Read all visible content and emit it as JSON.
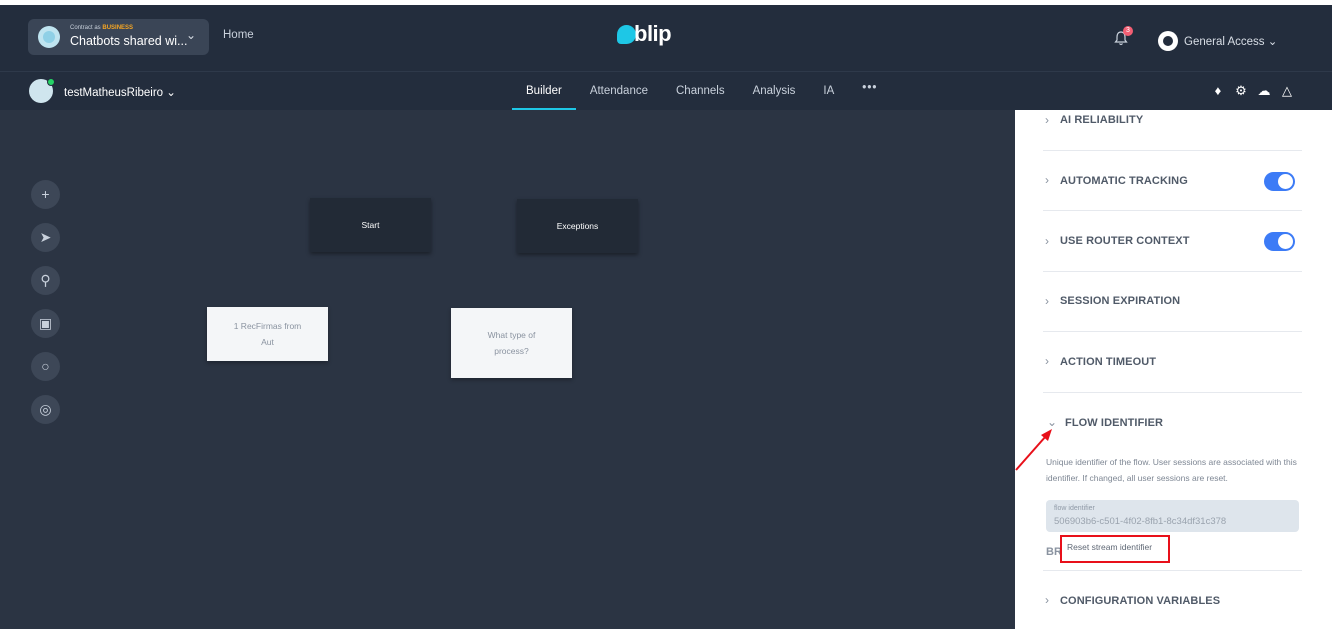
{
  "header": {
    "contract_prefix": "Contract as",
    "contract_plan": "BUSINESS",
    "contract_name": "Chatbots shared wi...",
    "home": "Home",
    "logo": "blip",
    "notifications": "3",
    "account": "General Access"
  },
  "subbar": {
    "bot_name": "testMatheusRibeiro",
    "tabs": [
      "Builder",
      "Attendance",
      "Channels",
      "Analysis",
      "IA",
      "•••"
    ]
  },
  "canvas": {
    "nodes": {
      "start": "Start",
      "exceptions": "Exceptions",
      "recfirmas": "1 RecFirmas from Aut",
      "process": "What type of process?"
    }
  },
  "panel": {
    "sections": {
      "ai_reliability": "AI RELIABILITY",
      "automatic_tracking": "AUTOMATIC TRACKING",
      "use_router_context": "USE ROUTER CONTEXT",
      "session_expiration": "SESSION EXPIRATION",
      "action_timeout": "ACTION TIMEOUT",
      "flow_identifier": "FLOW IDENTIFIER",
      "configuration_variables": "CONFIGURATION VARIABLES"
    },
    "flow_description": "Unique identifier of the flow. User sessions are associated with this identifier. If changed, all user sessions are reset.",
    "id_label": "flow identifier",
    "id_value": "506903b6-c501-4f02-8fb1-8c34df31c378",
    "br": "BR",
    "reset_button": "Reset stream identifier"
  },
  "colors": {
    "header_bg": "#232d3d",
    "canvas_bg": "#2b3443",
    "accent": "#1ec7e6",
    "toggle": "#3c7bf6",
    "highlight": "#e8101a"
  }
}
